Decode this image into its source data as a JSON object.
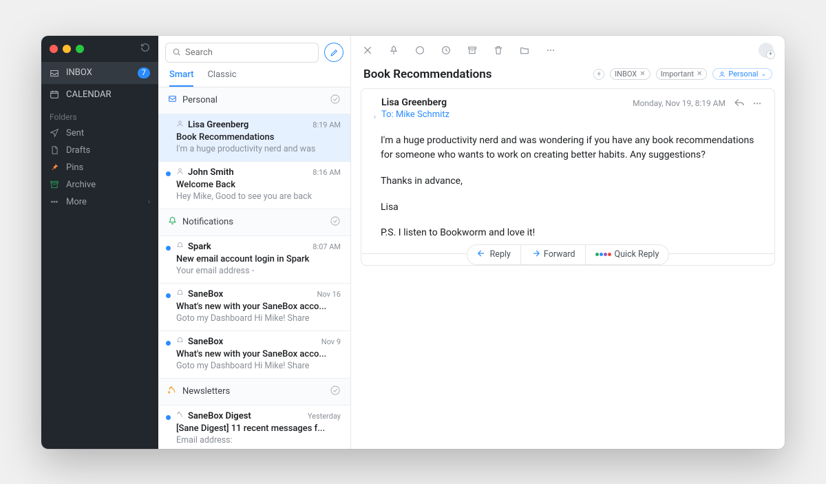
{
  "sidebar": {
    "nav": [
      {
        "label": "INBOX",
        "badge": "7"
      },
      {
        "label": "CALENDAR"
      }
    ],
    "folders_heading": "Folders",
    "folders": [
      {
        "label": "Sent"
      },
      {
        "label": "Drafts"
      },
      {
        "label": "Pins"
      },
      {
        "label": "Archive"
      },
      {
        "label": "More"
      }
    ]
  },
  "search": {
    "placeholder": "Search"
  },
  "tabs": {
    "smart": "Smart",
    "classic": "Classic"
  },
  "sections": [
    {
      "title": "Personal",
      "iconColor": "blue",
      "messages": [
        {
          "sender": "Lisa Greenberg",
          "time": "8:19 AM",
          "subject": "Book Recommendations",
          "preview": "I'm a huge productivity nerd and was",
          "unread": false,
          "selected": true
        },
        {
          "sender": "John Smith",
          "time": "8:16 AM",
          "subject": "Welcome Back",
          "preview": "Hey Mike, Good to see you are back",
          "unread": true
        }
      ]
    },
    {
      "title": "Notifications",
      "iconColor": "green",
      "messages": [
        {
          "sender": "Spark",
          "time": "8:07 AM",
          "subject": "New email account login in Spark",
          "preview": "Your email address -",
          "unread": true
        },
        {
          "sender": "SaneBox",
          "time": "Nov 16",
          "subject": "What's new with your SaneBox acco...",
          "preview": "Goto my Dashboard Hi Mike! Share",
          "unread": true
        },
        {
          "sender": "SaneBox",
          "time": "Nov 9",
          "subject": "What's new with your SaneBox acco...",
          "preview": "Goto my Dashboard Hi Mike! Share",
          "unread": true
        }
      ]
    },
    {
      "title": "Newsletters",
      "iconColor": "orange",
      "messages": [
        {
          "sender": "SaneBox Digest",
          "time": "Yesterday",
          "subject": "[Sane Digest] 11 recent messages f...",
          "preview": "Email address:",
          "unread": true
        }
      ]
    }
  ],
  "reader": {
    "subject": "Book Recommendations",
    "labels": {
      "l1": "INBOX",
      "l2": "Important",
      "l3": "Personal"
    },
    "from": "Lisa Greenberg",
    "to_prefix": "To: ",
    "to_name": "Mike Schmitz",
    "date": "Monday, Nov 19, 8:19 AM",
    "body": {
      "p1": "I'm a huge productivity nerd and was wondering if you have any book recommendations for someone who wants to work on creating better habits. Any suggestions?",
      "p2": "Thanks in advance,",
      "p3": "Lisa",
      "p4": "P.S. I listen to Bookworm and love it!"
    },
    "actions": {
      "reply": "Reply",
      "forward": "Forward",
      "quick": "Quick Reply"
    }
  }
}
